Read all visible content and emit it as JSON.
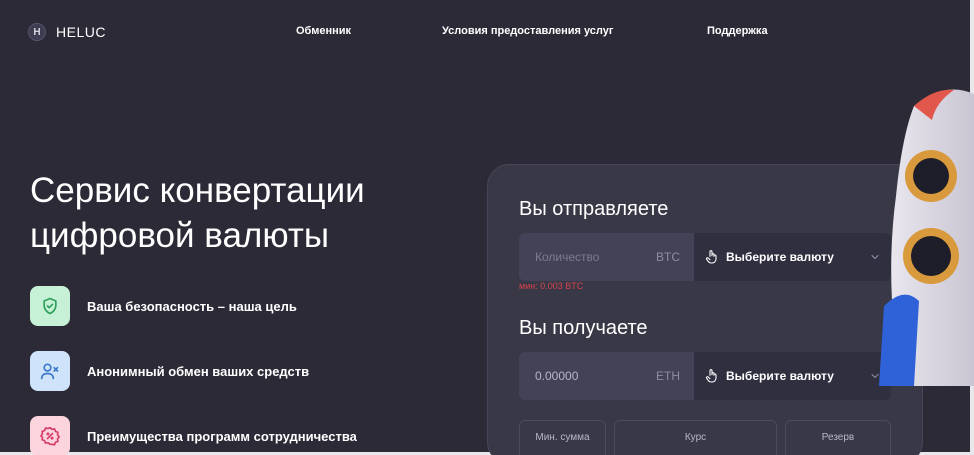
{
  "header": {
    "logo_letter": "H",
    "logo_text": "HELUC",
    "nav": [
      "Обменник",
      "Условия предоставления услуг",
      "Поддержка"
    ]
  },
  "hero": {
    "title_line1": "Сервис конвертации",
    "title_line2": "цифровой валюты"
  },
  "features": [
    {
      "label": "Ваша безопасность – наша цель",
      "icon": "shield-check-icon",
      "bg": "#c6f1d6"
    },
    {
      "label": "Анонимный обмен ваших средств",
      "icon": "user-x-icon",
      "bg": "#cfe3fb"
    },
    {
      "label": "Преимущества программ сотрудничества",
      "icon": "percent-badge-icon",
      "bg": "#fbd4dd"
    }
  ],
  "exchange": {
    "send": {
      "title": "Вы отправляете",
      "placeholder": "Количество",
      "code": "BTC",
      "select_label": "Выберите валюту",
      "min_note": "мин: 0.003 BTC"
    },
    "receive": {
      "title": "Вы получаете",
      "value": "0.00000",
      "code": "ETH",
      "select_label": "Выберите валюту"
    },
    "info": {
      "min_sum": "Мин. сумма",
      "rate": "Курс",
      "reserve": "Резерв"
    }
  },
  "colors": {
    "background": "#2b2a36",
    "card": "#393846",
    "error": "#d9434c"
  }
}
